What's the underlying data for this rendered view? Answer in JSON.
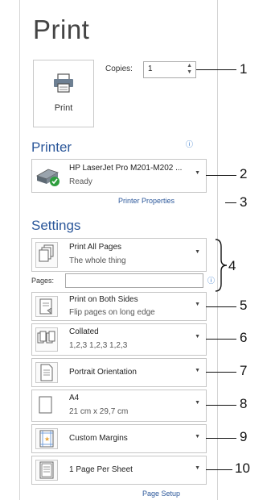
{
  "title": "Print",
  "print_button": {
    "label": "Print"
  },
  "copies": {
    "label": "Copies:",
    "value": "1"
  },
  "printer": {
    "heading": "Printer",
    "name": "HP LaserJet Pro M201-M202 ...",
    "status": "Ready",
    "properties_link": "Printer Properties"
  },
  "settings": {
    "heading": "Settings",
    "pages_label": "Pages:",
    "page_setup_link": "Page Setup",
    "items": [
      {
        "line1": "Print All Pages",
        "line2": "The whole thing"
      },
      {
        "line1": "Print on Both Sides",
        "line2": "Flip pages on long edge"
      },
      {
        "line1": "Collated",
        "line2": "1,2,3   1,2,3   1,2,3"
      },
      {
        "line1": "Portrait Orientation",
        "line2": ""
      },
      {
        "line1": "A4",
        "line2": "21 cm x 29,7 cm"
      },
      {
        "line1": "Custom Margins",
        "line2": ""
      },
      {
        "line1": "1 Page Per Sheet",
        "line2": ""
      }
    ]
  },
  "callouts": [
    "1",
    "2",
    "3",
    "4",
    "5",
    "6",
    "7",
    "8",
    "9",
    "10"
  ],
  "colors": {
    "accent": "#2b579a",
    "info": "#2b72c8",
    "border": "#c6c6c6"
  }
}
